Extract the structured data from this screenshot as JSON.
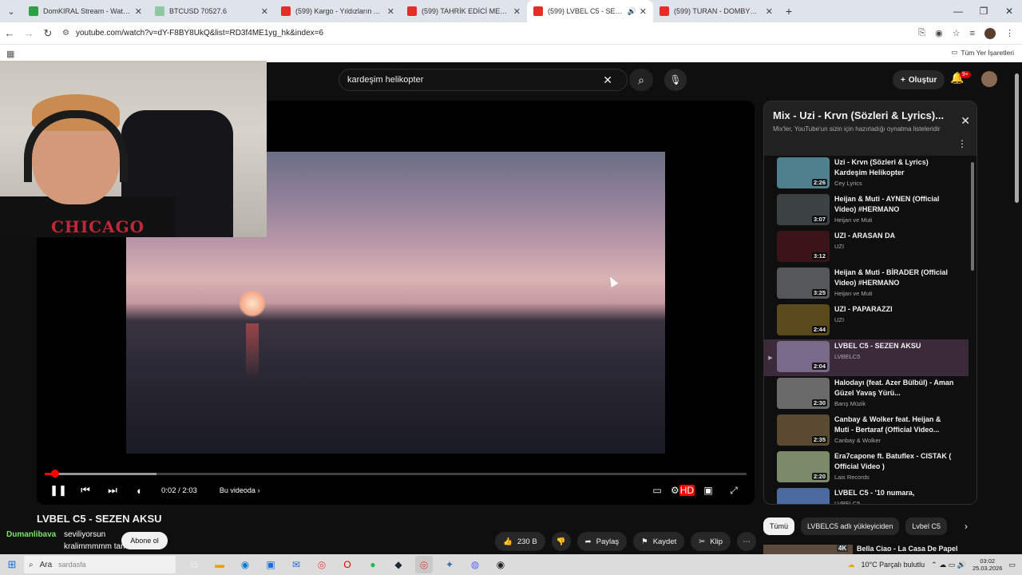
{
  "browser": {
    "tabs": [
      {
        "title": "DomKIRAL Stream - Watch Live",
        "color": "#2ea043"
      },
      {
        "title": "BTCUSD 70527.6",
        "color": "#8fc8a0"
      },
      {
        "title": "(599) Kargo - Yıldızların Altında",
        "color": "#e52d27"
      },
      {
        "title": "(599) TAHRİK EDİCİ MESAJLAR...",
        "color": "#e52d27"
      },
      {
        "title": "(599) LVBEL C5 - SEZEN AKS",
        "color": "#e52d27"
      },
      {
        "title": "(599) TURAN - DOMBYRA / mu",
        "color": "#e52d27"
      }
    ],
    "url": "youtube.com/watch?v=dY-F8BY8UkQ&list=RD3f4ME1yg_hk&index=6",
    "bookmarks_label": "Tüm Yer İşaretleri"
  },
  "yt": {
    "search_query": "kardeşim helikopter",
    "create_label": "Oluştur",
    "notif_count": "9+"
  },
  "player": {
    "time": "0:02 / 2:03",
    "chapter": "Bu videoda",
    "progress": 0.016
  },
  "video": {
    "title": "LVBEL C5 - SEZEN AKSU",
    "subscribe": "Abone ol",
    "likes": "230 B",
    "share": "Paylaş",
    "save": "Kaydet",
    "clip": "Klip"
  },
  "chat": {
    "user": "Dumanlibava",
    "msg1": "seviliyorsun",
    "msg2": "kralimmmmm tam"
  },
  "playlist": {
    "title": "Mix - Uzi - Krvn (Sözleri & Lyrics)...",
    "subtitle": "Mix'ler, YouTube'un sizin için hazırladığı oynatma listeleridir",
    "items": [
      {
        "title": "Uzi - Krvn (Sözleri & Lyrics) Kardeşim Helikopter",
        "channel": "Cey Lyrics",
        "dur": "2:26",
        "color": "#4f7f8c"
      },
      {
        "title": "Heijan & Muti - AYNEN (Official Video) #HERMANO",
        "channel": "Heijan ve Muti",
        "dur": "3:07",
        "color": "#3c4242"
      },
      {
        "title": "UZI - ARASAN DA",
        "channel": "UZI",
        "dur": "3:12",
        "color": "#3a1418"
      },
      {
        "title": "Heijan & Muti - BİRADER (Official Video) #HERMANO",
        "channel": "Heijan ve Muti",
        "dur": "3:25",
        "color": "#55585a"
      },
      {
        "title": "UZI - PAPARAZZI",
        "channel": "UZI",
        "dur": "2:44",
        "color": "#5a4a1e"
      },
      {
        "title": "LVBEL C5 - SEZEN AKSU",
        "channel": "LVBELC5",
        "dur": "2:04",
        "color": "#7a6a8a"
      },
      {
        "title": "Halodayı (feat. Azer Bülbül) - Aman Güzel Yavaş Yürü...",
        "channel": "Barış Müzik",
        "dur": "2:30",
        "color": "#6a6a6a"
      },
      {
        "title": "Canbay & Wolker feat. Heijan & Muti - Bertaraf (Official Video...",
        "channel": "Canbay & Wolker",
        "dur": "2:35",
        "color": "#5a4a32"
      },
      {
        "title": "Era7capone ft. Batuflex - CISTAK ( Official Video )",
        "channel": "Lais Records",
        "dur": "2:20",
        "color": "#7a8a6a"
      },
      {
        "title": "LVBEL C5 - '10 numara,",
        "channel": "LVBELC5",
        "dur": "",
        "color": "#4a6aa0"
      }
    ],
    "active_index": 5
  },
  "chips": [
    "Tümü",
    "LVBELC5 adlı yükleyiciden",
    "Lvbel C5"
  ],
  "recommendation": {
    "title": "Bella Ciao - La Casa De Papel",
    "badge": "4K"
  },
  "webcam": {
    "shirt": "CHICAGO"
  },
  "taskbar": {
    "search_label": "Ara",
    "search_ghost": "sardasfa",
    "weather": "10°C  Parçalı bulutlu",
    "time": "03:02",
    "date": "25.03.2026"
  }
}
